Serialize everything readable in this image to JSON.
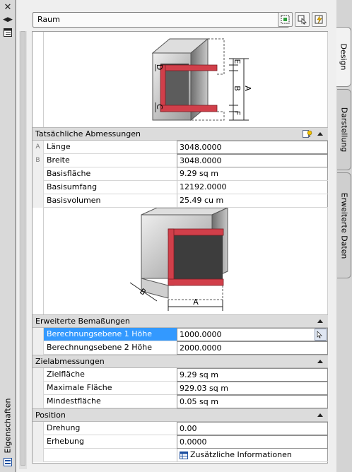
{
  "palette": {
    "title": "Eigenschaften"
  },
  "toolbar": {
    "style_selector": "Raum"
  },
  "tabs": [
    "Design",
    "Darstellung",
    "Erweiterte Daten"
  ],
  "diagram1": {
    "labels": [
      "D",
      "E",
      "B",
      "A",
      "C",
      "F"
    ]
  },
  "diagram2": {
    "labels": [
      "B",
      "A"
    ]
  },
  "sections": {
    "actual_dims": {
      "title": "Tatsächliche Abmessungen",
      "rows": [
        {
          "marker": "A",
          "label": "Länge",
          "value": "3048.0000"
        },
        {
          "marker": "B",
          "label": "Breite",
          "value": "3048.0000"
        },
        {
          "marker": "",
          "label": "Basisfläche",
          "value": "9.29 sq m"
        },
        {
          "marker": "",
          "label": "Basisumfang",
          "value": "12192.0000"
        },
        {
          "marker": "",
          "label": "Basisvolumen",
          "value": "25.49  cu m"
        }
      ]
    },
    "extended": {
      "title": "Erweiterte Bemaßungen",
      "rows": [
        {
          "label": "Berechnungsebene 1 Höhe",
          "value": "1000.0000"
        },
        {
          "label": "Berechnungsebene 2 Höhe",
          "value": "2000.0000"
        }
      ]
    },
    "target": {
      "title": "Zielabmessungen",
      "rows": [
        {
          "label": "Zielfläche",
          "value": "9.29 sq m"
        },
        {
          "label": "Maximale Fläche",
          "value": "929.03 sq m"
        },
        {
          "label": "Mindestfläche",
          "value": "0.05 sq m"
        }
      ]
    },
    "position": {
      "title": "Position",
      "rows": [
        {
          "label": "Drehung",
          "value": "0.00"
        },
        {
          "label": "Erhebung",
          "value": "0.0000"
        }
      ],
      "extra_button": "Zusätzliche Informationen"
    }
  },
  "colors": {
    "selection": "#3399ff",
    "accent_red": "#d13f4a"
  }
}
